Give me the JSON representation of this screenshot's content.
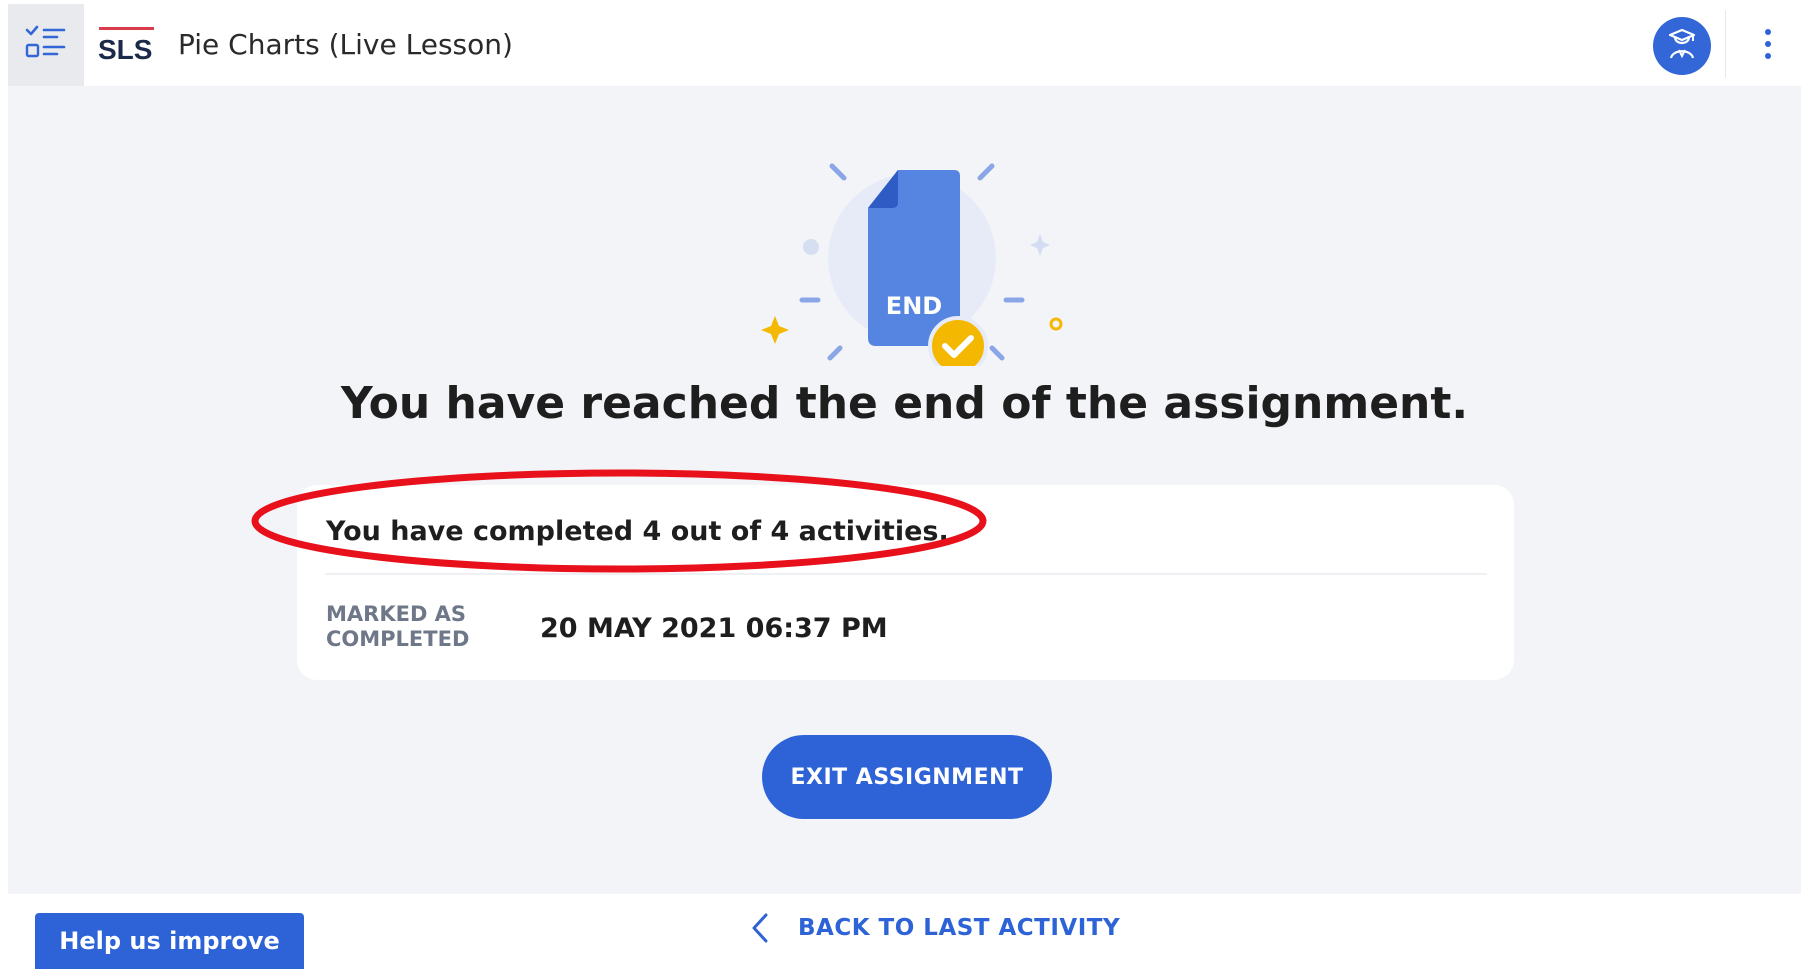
{
  "header": {
    "logo_text": "SLS",
    "lesson_title": "Pie Charts (Live Lesson)",
    "icons": {
      "menu": "checklist-icon",
      "avatar": "student-avatar-icon",
      "more": "kebab-menu-icon"
    }
  },
  "main": {
    "illustration": {
      "doc_label": "END",
      "icon": "check-badge-icon"
    },
    "heading": "You have reached the end of the assignment.",
    "summary": {
      "activities_text": "You have completed 4 out of 4 activities.",
      "marked_label": "MARKED AS COMPLETED",
      "marked_value": "20 MAY 2021 06:37 PM"
    },
    "exit_label": "EXIT ASSIGNMENT"
  },
  "footer": {
    "help_label": "Help us improve",
    "back_label": "BACK TO LAST ACTIVITY",
    "back_icon": "chevron-left-icon"
  },
  "colors": {
    "accent": "#2d63d6",
    "page_bg": "#f3f4f8",
    "highlight": "#e8101a",
    "check_badge": "#f5b800"
  }
}
